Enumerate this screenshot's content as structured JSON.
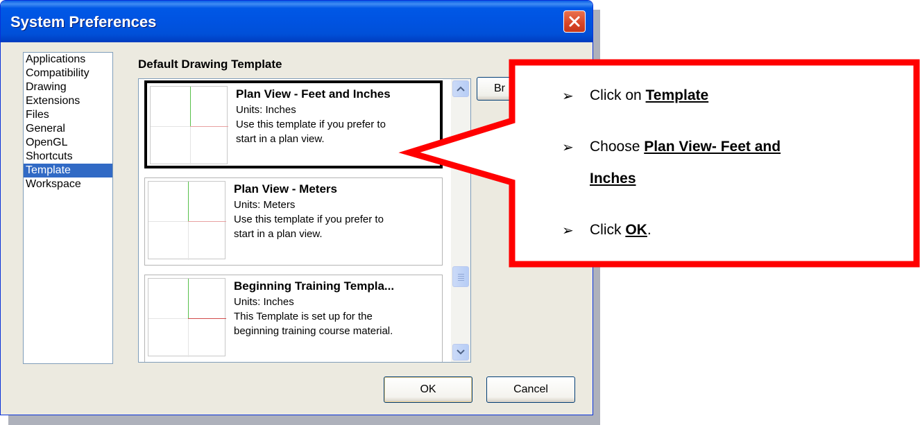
{
  "dialog": {
    "title": "System Preferences",
    "close_glyph": "✕"
  },
  "categories": [
    "Applications",
    "Compatibility",
    "Drawing",
    "Extensions",
    "Files",
    "General",
    "OpenGL",
    "Shortcuts",
    "Template",
    "Workspace"
  ],
  "selected_category": "Template",
  "section_label": "Default Drawing Template",
  "templates": [
    {
      "name": "Plan View - Feet and Inches",
      "units": "Units: Inches",
      "desc1": "Use this template if you prefer to",
      "desc2": "start in a plan view."
    },
    {
      "name": "Plan View - Meters",
      "units": "Units: Meters",
      "desc1": "Use this template if you prefer to",
      "desc2": "start in a plan view."
    },
    {
      "name": "Beginning Training Templa...",
      "units": "Units: Inches",
      "desc1": "This Template is set up for the",
      "desc2": "beginning training course material."
    }
  ],
  "browse_label": "Br",
  "buttons": {
    "ok": "OK",
    "cancel": "Cancel"
  },
  "callout": {
    "border_color": "#ff0000",
    "bullet1_prefix": "Click on ",
    "bullet1_bold": "Template",
    "bullet2_prefix": "Choose ",
    "bullet2_bold_a": "Plan View- Feet and",
    "bullet2_bold_b": "Inches",
    "bullet3_prefix": "Click ",
    "bullet3_bold": "OK",
    "bullet3_suffix": "."
  }
}
